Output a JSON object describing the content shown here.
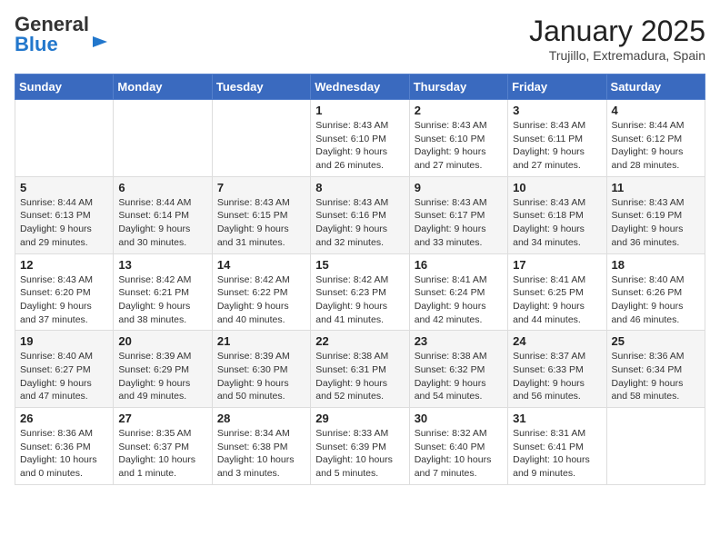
{
  "header": {
    "logo_general": "General",
    "logo_blue": "Blue",
    "month_title": "January 2025",
    "location": "Trujillo, Extremadura, Spain"
  },
  "weekdays": [
    "Sunday",
    "Monday",
    "Tuesday",
    "Wednesday",
    "Thursday",
    "Friday",
    "Saturday"
  ],
  "weeks": [
    [
      {
        "day": "",
        "info": ""
      },
      {
        "day": "",
        "info": ""
      },
      {
        "day": "",
        "info": ""
      },
      {
        "day": "1",
        "info": "Sunrise: 8:43 AM\nSunset: 6:10 PM\nDaylight: 9 hours and 26 minutes."
      },
      {
        "day": "2",
        "info": "Sunrise: 8:43 AM\nSunset: 6:10 PM\nDaylight: 9 hours and 27 minutes."
      },
      {
        "day": "3",
        "info": "Sunrise: 8:43 AM\nSunset: 6:11 PM\nDaylight: 9 hours and 27 minutes."
      },
      {
        "day": "4",
        "info": "Sunrise: 8:44 AM\nSunset: 6:12 PM\nDaylight: 9 hours and 28 minutes."
      }
    ],
    [
      {
        "day": "5",
        "info": "Sunrise: 8:44 AM\nSunset: 6:13 PM\nDaylight: 9 hours and 29 minutes."
      },
      {
        "day": "6",
        "info": "Sunrise: 8:44 AM\nSunset: 6:14 PM\nDaylight: 9 hours and 30 minutes."
      },
      {
        "day": "7",
        "info": "Sunrise: 8:43 AM\nSunset: 6:15 PM\nDaylight: 9 hours and 31 minutes."
      },
      {
        "day": "8",
        "info": "Sunrise: 8:43 AM\nSunset: 6:16 PM\nDaylight: 9 hours and 32 minutes."
      },
      {
        "day": "9",
        "info": "Sunrise: 8:43 AM\nSunset: 6:17 PM\nDaylight: 9 hours and 33 minutes."
      },
      {
        "day": "10",
        "info": "Sunrise: 8:43 AM\nSunset: 6:18 PM\nDaylight: 9 hours and 34 minutes."
      },
      {
        "day": "11",
        "info": "Sunrise: 8:43 AM\nSunset: 6:19 PM\nDaylight: 9 hours and 36 minutes."
      }
    ],
    [
      {
        "day": "12",
        "info": "Sunrise: 8:43 AM\nSunset: 6:20 PM\nDaylight: 9 hours and 37 minutes."
      },
      {
        "day": "13",
        "info": "Sunrise: 8:42 AM\nSunset: 6:21 PM\nDaylight: 9 hours and 38 minutes."
      },
      {
        "day": "14",
        "info": "Sunrise: 8:42 AM\nSunset: 6:22 PM\nDaylight: 9 hours and 40 minutes."
      },
      {
        "day": "15",
        "info": "Sunrise: 8:42 AM\nSunset: 6:23 PM\nDaylight: 9 hours and 41 minutes."
      },
      {
        "day": "16",
        "info": "Sunrise: 8:41 AM\nSunset: 6:24 PM\nDaylight: 9 hours and 42 minutes."
      },
      {
        "day": "17",
        "info": "Sunrise: 8:41 AM\nSunset: 6:25 PM\nDaylight: 9 hours and 44 minutes."
      },
      {
        "day": "18",
        "info": "Sunrise: 8:40 AM\nSunset: 6:26 PM\nDaylight: 9 hours and 46 minutes."
      }
    ],
    [
      {
        "day": "19",
        "info": "Sunrise: 8:40 AM\nSunset: 6:27 PM\nDaylight: 9 hours and 47 minutes."
      },
      {
        "day": "20",
        "info": "Sunrise: 8:39 AM\nSunset: 6:29 PM\nDaylight: 9 hours and 49 minutes."
      },
      {
        "day": "21",
        "info": "Sunrise: 8:39 AM\nSunset: 6:30 PM\nDaylight: 9 hours and 50 minutes."
      },
      {
        "day": "22",
        "info": "Sunrise: 8:38 AM\nSunset: 6:31 PM\nDaylight: 9 hours and 52 minutes."
      },
      {
        "day": "23",
        "info": "Sunrise: 8:38 AM\nSunset: 6:32 PM\nDaylight: 9 hours and 54 minutes."
      },
      {
        "day": "24",
        "info": "Sunrise: 8:37 AM\nSunset: 6:33 PM\nDaylight: 9 hours and 56 minutes."
      },
      {
        "day": "25",
        "info": "Sunrise: 8:36 AM\nSunset: 6:34 PM\nDaylight: 9 hours and 58 minutes."
      }
    ],
    [
      {
        "day": "26",
        "info": "Sunrise: 8:36 AM\nSunset: 6:36 PM\nDaylight: 10 hours and 0 minutes."
      },
      {
        "day": "27",
        "info": "Sunrise: 8:35 AM\nSunset: 6:37 PM\nDaylight: 10 hours and 1 minute."
      },
      {
        "day": "28",
        "info": "Sunrise: 8:34 AM\nSunset: 6:38 PM\nDaylight: 10 hours and 3 minutes."
      },
      {
        "day": "29",
        "info": "Sunrise: 8:33 AM\nSunset: 6:39 PM\nDaylight: 10 hours and 5 minutes."
      },
      {
        "day": "30",
        "info": "Sunrise: 8:32 AM\nSunset: 6:40 PM\nDaylight: 10 hours and 7 minutes."
      },
      {
        "day": "31",
        "info": "Sunrise: 8:31 AM\nSunset: 6:41 PM\nDaylight: 10 hours and 9 minutes."
      },
      {
        "day": "",
        "info": ""
      }
    ]
  ]
}
